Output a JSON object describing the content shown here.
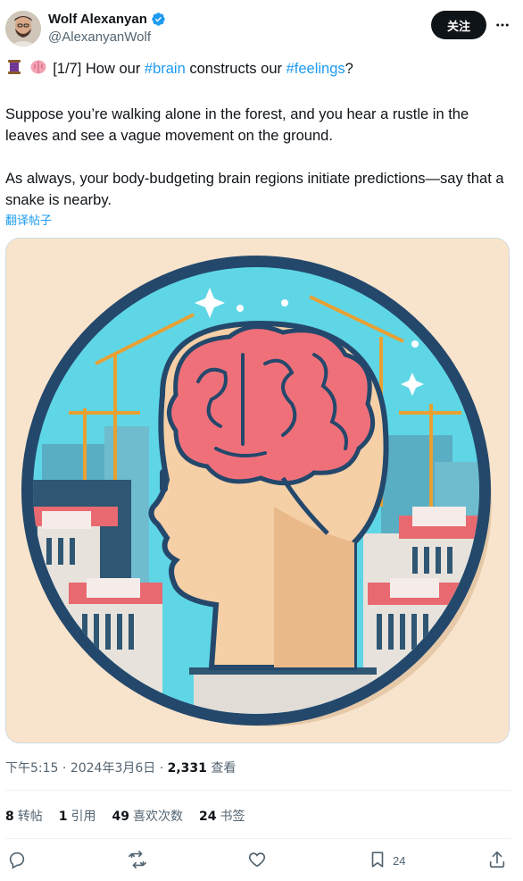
{
  "author": {
    "name": "Wolf Alexanyan",
    "handle": "@AlexanyanWolf",
    "verified": true
  },
  "header": {
    "follow_label": "关注",
    "more_icon": "more-icon"
  },
  "tweet": {
    "line1_prefix": "[1/7] How our ",
    "hashtag1": "#brain",
    "line1_mid": " constructs our ",
    "hashtag2": "#feelings",
    "line1_suffix": "?",
    "emojis": [
      "thread-spool-icon",
      "brain-icon"
    ],
    "paragraph2": "Suppose you’re walking alone in the forest, and you hear a rustle in the leaves and see a vague movement on the ground.",
    "paragraph3": "As always, your body-budgeting brain regions initiate predictions—say that a snake is nearby."
  },
  "translate_label": "翻译帖子",
  "meta": {
    "time": "下午5:15",
    "separator1": " · ",
    "date": "2024年3月6日",
    "separator2": " · ",
    "views_count": "2,331",
    "views_label": " 查看"
  },
  "stats": [
    {
      "count": "8",
      "label": "转帖"
    },
    {
      "count": "1",
      "label": "引用"
    },
    {
      "count": "49",
      "label": "喜欢次数"
    },
    {
      "count": "24",
      "label": "书签"
    }
  ],
  "actions": {
    "reply_icon": "reply-icon",
    "retweet_icon": "retweet-icon",
    "like_icon": "heart-icon",
    "bookmark_icon": "bookmark-icon",
    "bookmark_count": "24",
    "share_icon": "share-icon"
  },
  "colors": {
    "accent": "#1d9bf0",
    "text": "#0f1419",
    "secondary": "#536471",
    "image_bg": "#f8e4cc",
    "sky": "#5fd6e6",
    "brain": "#f0707a"
  }
}
